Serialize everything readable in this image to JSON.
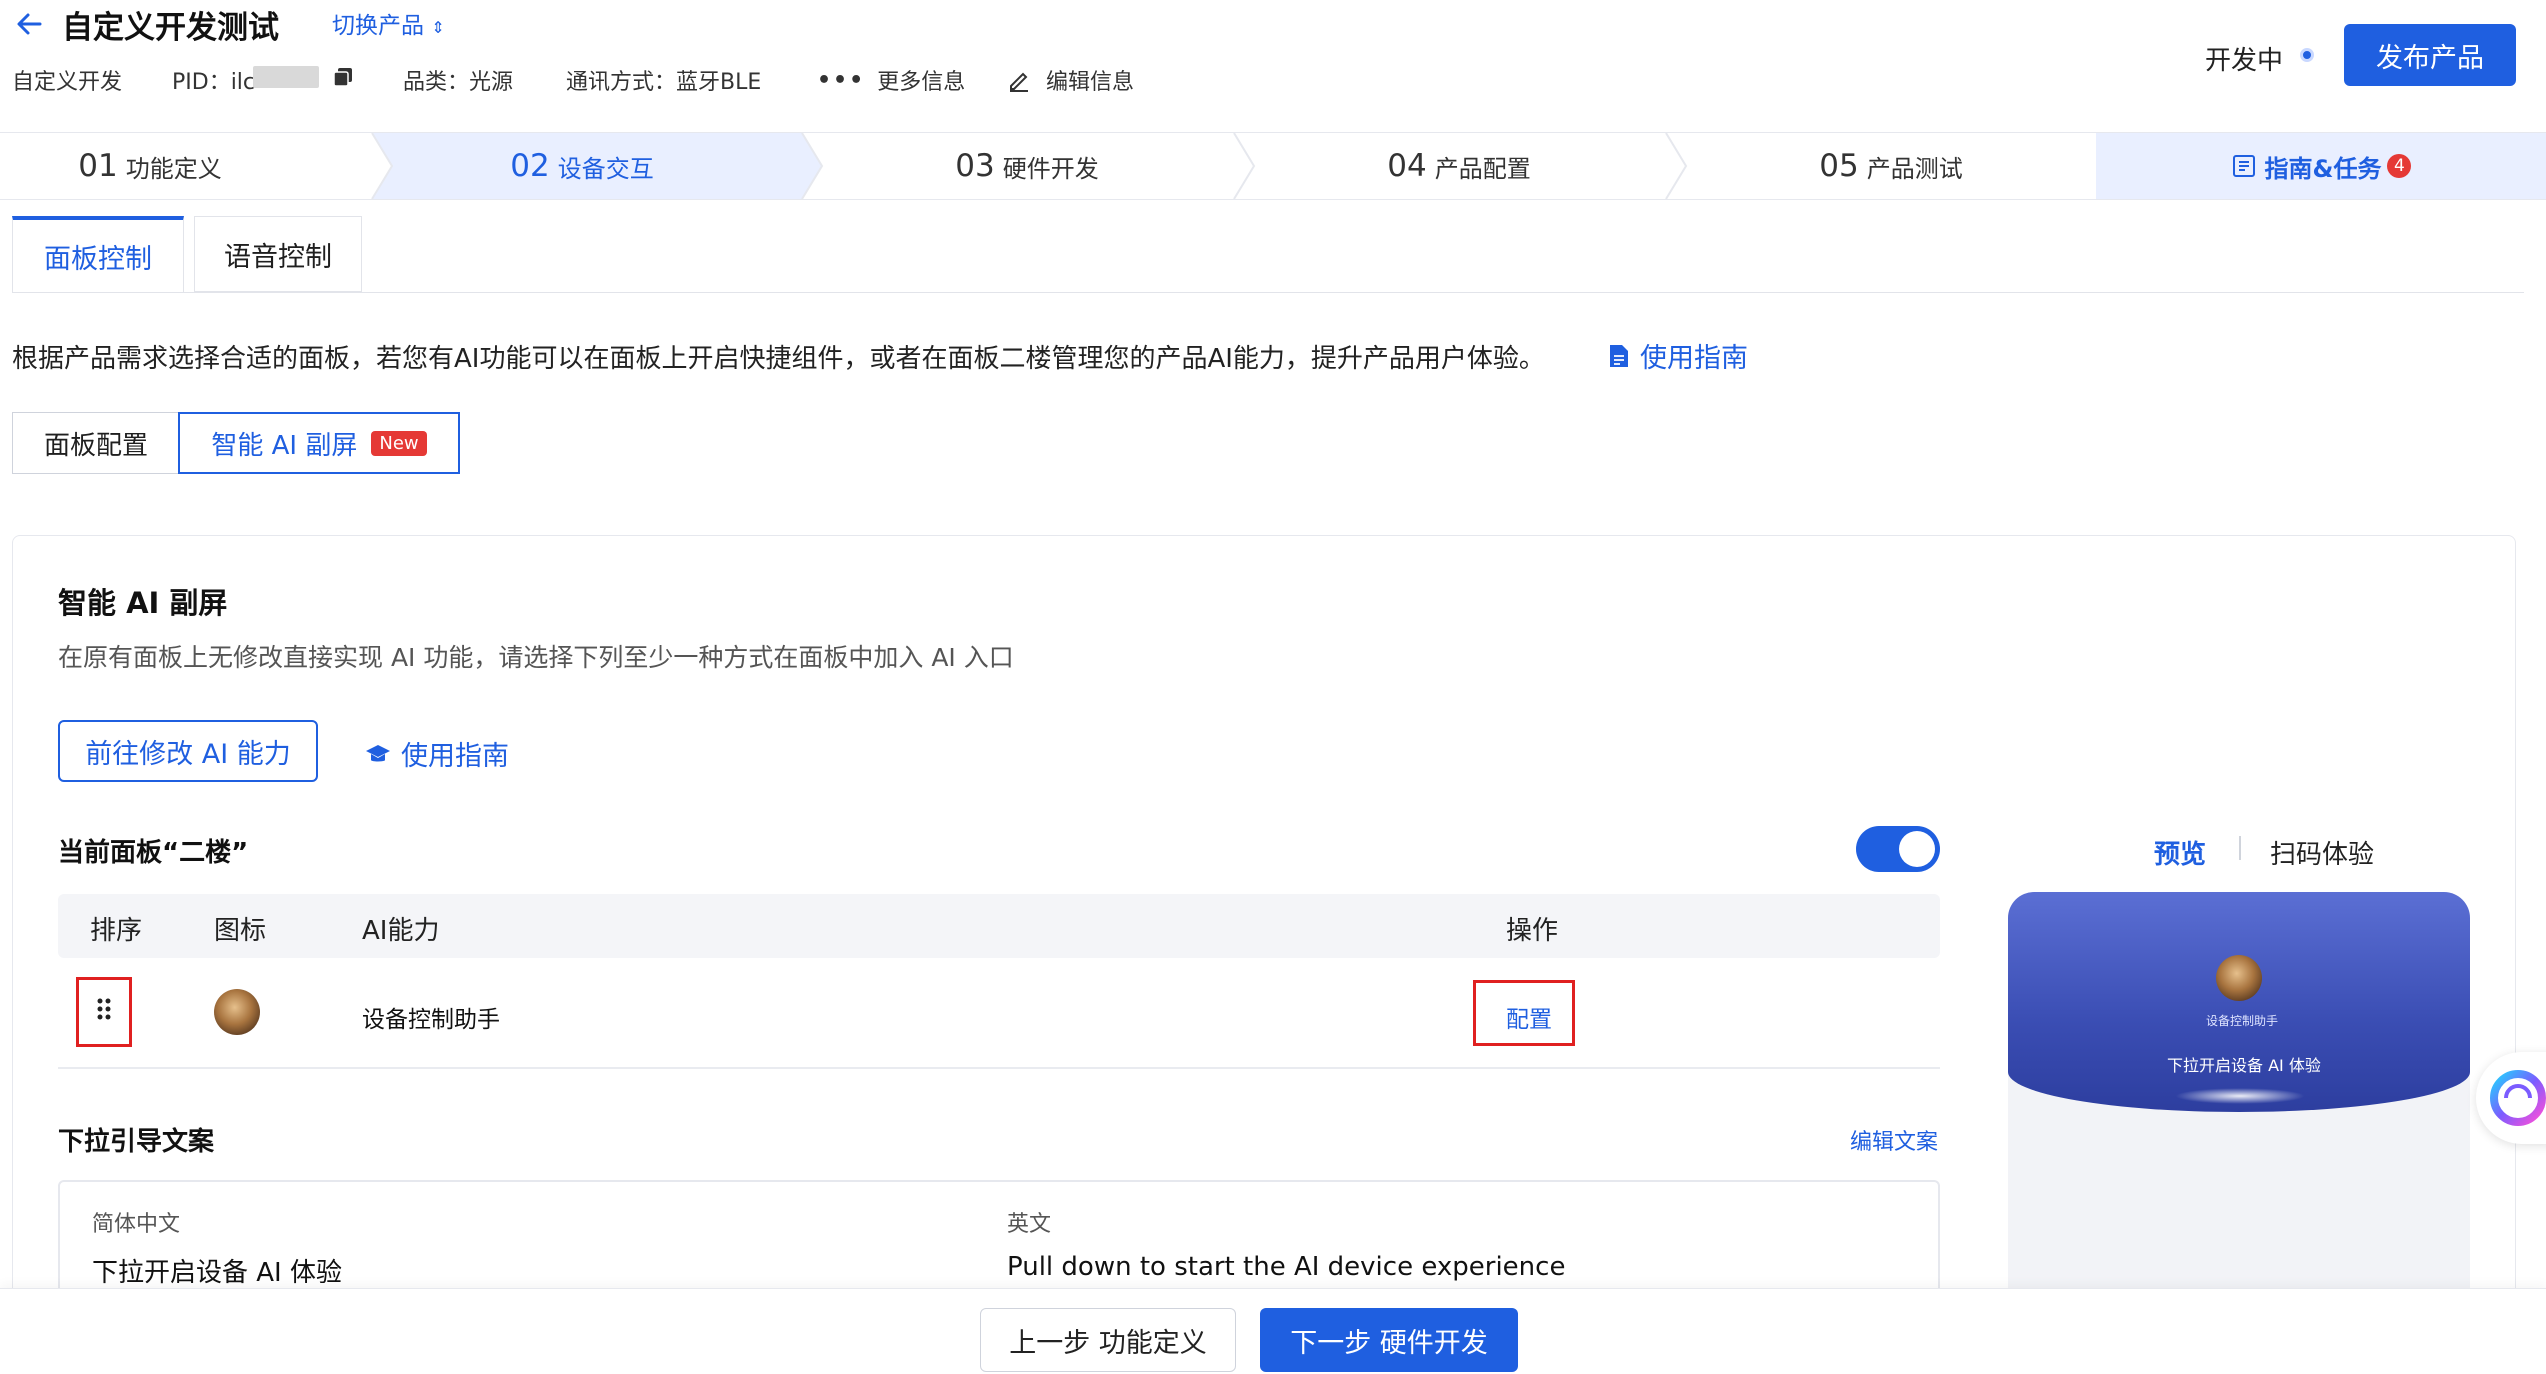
{
  "header": {
    "title": "自定义开发测试",
    "switch_product": "切换产品",
    "meta": {
      "dev_type": "自定义开发",
      "pid_label": "PID：ilc",
      "category": "品类：光源",
      "protocol": "通讯方式：蓝牙BLE",
      "more_info": "更多信息",
      "edit_info": "编辑信息"
    },
    "status": "开发中",
    "publish": "发布产品"
  },
  "steps": [
    {
      "num": "01",
      "label": "功能定义"
    },
    {
      "num": "02",
      "label": "设备交互"
    },
    {
      "num": "03",
      "label": "硬件开发"
    },
    {
      "num": "04",
      "label": "产品配置"
    },
    {
      "num": "05",
      "label": "产品测试"
    }
  ],
  "guide_tab": {
    "label": "指南&任务",
    "badge": "4"
  },
  "active_step": 2,
  "tabs": [
    "面板控制",
    "语音控制"
  ],
  "description": "根据产品需求选择合适的面板，若您有AI功能可以在面板上开启快捷组件，或者在面板二楼管理您的产品AI能力，提升产品用户体验。",
  "usage_guide": "使用指南",
  "segments": {
    "panel_config": "面板配置",
    "ai_screen": "智能 AI 副屏",
    "new_badge": "New"
  },
  "card": {
    "title": "智能 AI 副屏",
    "subtitle": "在原有面板上无修改直接实现 AI 功能，请选择下列至少一种方式在面板中加入 AI 入口",
    "goto_button": "前往修改 AI 能力",
    "guide": "使用指南",
    "current_panel": "当前面板“二楼”",
    "toggle_on": true,
    "table": {
      "headers": {
        "order": "排序",
        "icon": "图标",
        "ability": "AI能力",
        "action": "操作"
      },
      "rows": [
        {
          "ability": "设备控制助手",
          "action": "配置"
        }
      ]
    },
    "pull_title": "下拉引导文案",
    "edit_copy": "编辑文案",
    "copy": {
      "zh_label": "简体中文",
      "zh_value": "下拉开启设备 AI 体验",
      "en_label": "英文",
      "en_value": "Pull down to start the AI device experience"
    }
  },
  "preview": {
    "preview_tab": "预览",
    "scan_tab": "扫码体验",
    "assistant_name": "设备控制助手",
    "pull_guide": "下拉开启设备 AI 体验"
  },
  "footer": {
    "prev": "上一步 功能定义",
    "next": "下一步 硬件开发"
  },
  "colors": {
    "accent": "#1f5fe0",
    "danger": "#e02020"
  }
}
